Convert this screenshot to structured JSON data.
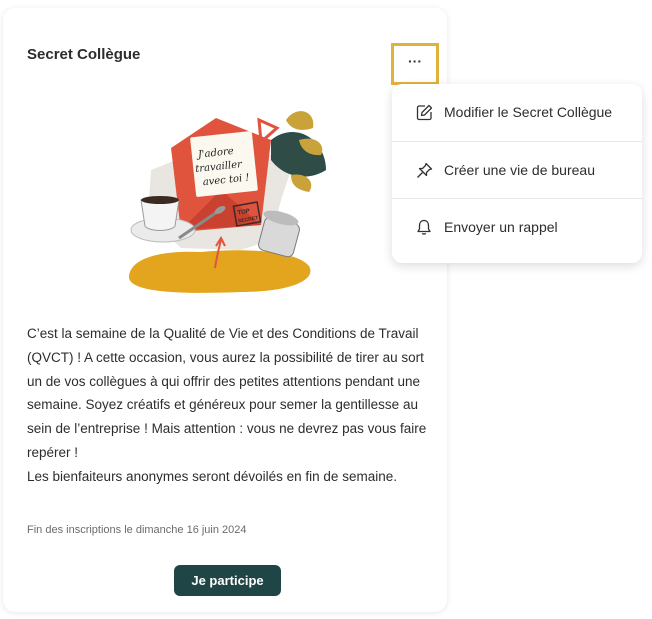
{
  "card": {
    "title": "Secret Collègue",
    "more_button_label": "···",
    "description": [
      "C’est la semaine de la Qualité de Vie et des Conditions de Travail (QVCT) ! A cette occasion, vous aurez la possibilité de tirer au sort un de vos collègues à qui offrir des petites attentions pendant une semaine. Soyez créatifs et généreux pour semer la gentillesse au sein de l’entreprise ! Mais attention : vous ne devrez pas vous faire repérer !",
      "Les bienfaiteurs anonymes seront dévoilés en fin de semaine."
    ],
    "deadline": "Fin des inscriptions le dimanche 16 juin 2024",
    "cta_label": "Je participe",
    "illustration": {
      "note_text": [
        "J'adore",
        "travailler",
        "avec toi !"
      ],
      "stamp_text": [
        "TOP",
        "SECRET"
      ]
    }
  },
  "menu": {
    "items": [
      {
        "label": "Modifier le Secret Collègue",
        "icon": "edit-icon"
      },
      {
        "label": "Créer une vie de bureau",
        "icon": "pin-icon"
      },
      {
        "label": "Envoyer un rappel",
        "icon": "bell-icon"
      }
    ]
  },
  "colors": {
    "highlight": "#e1b23a",
    "cta_background": "#1f4546",
    "envelope": "#e0533d",
    "blob": "#e3a41e"
  }
}
